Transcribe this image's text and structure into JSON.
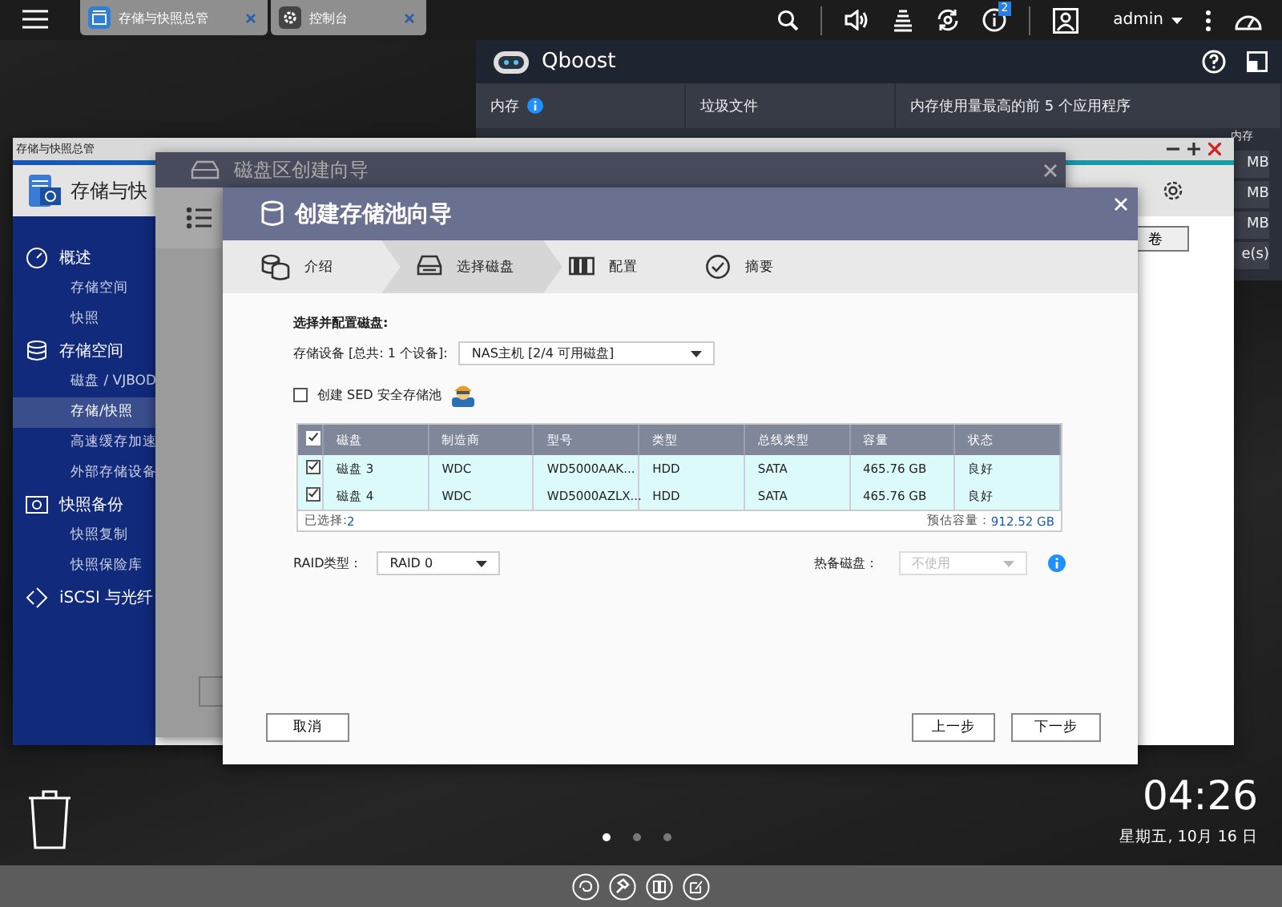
{
  "top_bar": {
    "tabs": [
      {
        "label": "存储与快照总管"
      },
      {
        "label": "控制台"
      }
    ],
    "notification_count": "2",
    "user": "admin"
  },
  "qboost": {
    "title": "Qboost",
    "columns": [
      "内存",
      "垃圾文件",
      "内存使用量最高的前 5 个应用程序"
    ],
    "side_column": "内存",
    "side_cells": [
      "MB",
      "MB",
      "MB",
      "e(s)"
    ]
  },
  "storage_window": {
    "title": "存储与快照总管",
    "app_title": "存储与快",
    "action_button": "卷",
    "sidebar": [
      {
        "label": "概述",
        "children": [
          {
            "label": "存储空间",
            "selected": false
          },
          {
            "label": "快照",
            "selected": false
          }
        ]
      },
      {
        "label": "存储空间",
        "children": [
          {
            "label": "磁盘 / VJBOD",
            "selected": false
          },
          {
            "label": "存储/快照",
            "selected": true
          },
          {
            "label": "高速缓存加速",
            "selected": false
          },
          {
            "label": "外部存储设备",
            "selected": false
          }
        ]
      },
      {
        "label": "快照备份",
        "children": [
          {
            "label": "快照复制",
            "selected": false
          },
          {
            "label": "快照保险库",
            "selected": false
          }
        ]
      },
      {
        "label": "iSCSI 与光纤"
      }
    ]
  },
  "volume_wizard": {
    "title": "磁盘区创建向导"
  },
  "pool_wizard": {
    "title": "创建存储池向导",
    "steps": [
      {
        "label": "介绍",
        "selected": false
      },
      {
        "label": "选择磁盘",
        "selected": true
      },
      {
        "label": "配置",
        "selected": false
      },
      {
        "label": "摘要",
        "selected": false
      }
    ],
    "section_title": "选择并配置磁盘:",
    "device_label": "存储设备 [总共: 1 个设备]:",
    "device_value": "NAS主机 [2/4 可用磁盘]",
    "sed": {
      "label": "创建 SED 安全存储池",
      "checked": false
    },
    "table": {
      "header_checked": true,
      "columns": [
        "磁盘",
        "制造商",
        "型号",
        "类型",
        "总线类型",
        "容量",
        "状态"
      ],
      "rows": [
        {
          "checked": true,
          "selected": true,
          "cells": [
            "磁盘 3",
            "WDC",
            "WD5000AAK...",
            "HDD",
            "SATA",
            "465.76 GB",
            "良好"
          ]
        },
        {
          "checked": true,
          "selected": true,
          "cells": [
            "磁盘 4",
            "WDC",
            "WD5000AZLX...",
            "HDD",
            "SATA",
            "465.76 GB",
            "良好"
          ]
        }
      ],
      "selected_label": "已选择:",
      "selected_count": "2",
      "capacity_label": "预估容量：",
      "capacity": "912.52 GB"
    },
    "raid_label": "RAID类型：",
    "raid_value": "RAID 0",
    "spare_label": "热备磁盘：",
    "spare_value": "不使用",
    "spare_disabled": true,
    "buttons": {
      "cancel": "取消",
      "back": "上一步",
      "next": "下一步"
    }
  },
  "desktop": {
    "time": "04:26",
    "date": "星期五, 10月 16 日",
    "pages": [
      {
        "selected": true
      },
      {
        "selected": false
      },
      {
        "selected": false
      }
    ]
  }
}
